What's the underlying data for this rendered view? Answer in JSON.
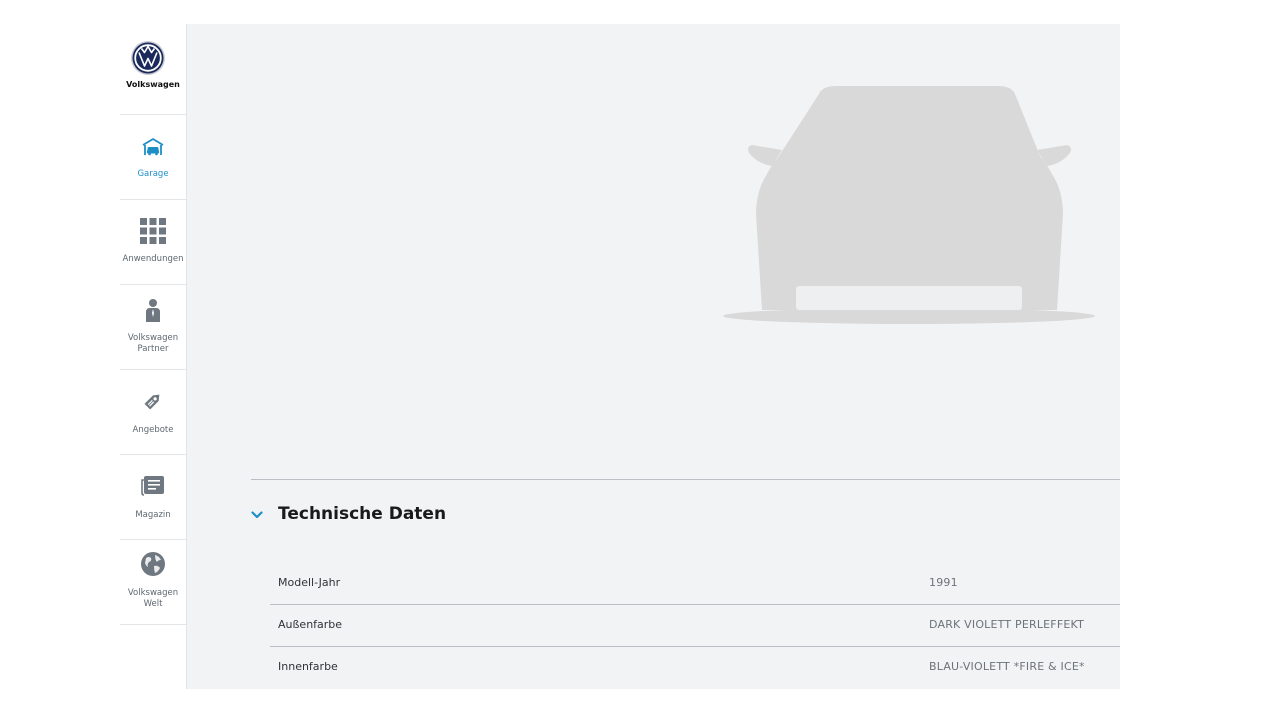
{
  "brand": {
    "name": "Volkswagen"
  },
  "sidebar": {
    "items": [
      {
        "label": "Garage",
        "icon": "garage-icon",
        "active": true
      },
      {
        "label": "Anwendungen",
        "icon": "apps-grid-icon"
      },
      {
        "label": "Volkswagen Partner",
        "icon": "partner-person-icon"
      },
      {
        "label": "Angebote",
        "icon": "tag-icon"
      },
      {
        "label": "Magazin",
        "icon": "magazine-icon"
      },
      {
        "label": "Volkswagen Welt",
        "icon": "globe-icon"
      }
    ]
  },
  "main": {
    "car_image": "car-silhouette-placeholder",
    "section": {
      "title": "Technische Daten",
      "expanded": true,
      "rows": [
        {
          "label": "Modell-Jahr",
          "value": "1991"
        },
        {
          "label": "Außenfarbe",
          "value": "DARK VIOLETT PERLEFFEKT"
        },
        {
          "label": "Innenfarbe",
          "value": "BLAU-VIOLETT *FIRE & ICE*"
        }
      ]
    }
  },
  "colors": {
    "accent": "#1d8fc7",
    "icon_gray": "#6f7880",
    "main_bg": "#f2f3f5",
    "car_silhouette": "#d9d9d9",
    "vw_blue": "#1b2a5c"
  }
}
